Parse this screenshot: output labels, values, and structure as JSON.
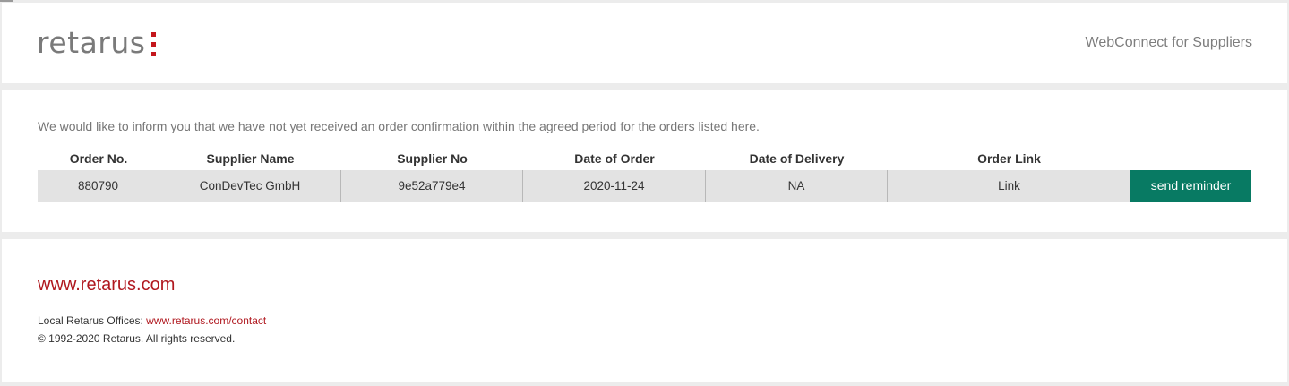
{
  "header": {
    "logo_text": "retarus",
    "title": "WebConnect for Suppliers"
  },
  "main": {
    "intro": "We would like to inform you that we have not yet received an order confirmation within the agreed period for the orders listed here.",
    "table": {
      "columns": [
        "Order No.",
        "Supplier Name",
        "Supplier No",
        "Date of Order",
        "Date of Delivery",
        "Order Link",
        ""
      ],
      "rows": [
        {
          "order_no": "880790",
          "supplier_name": "ConDevTec GmbH",
          "supplier_no": "9e52a779e4",
          "date_of_order": "2020-11-24",
          "date_of_delivery": "NA",
          "order_link": "Link",
          "action": "send reminder"
        }
      ]
    }
  },
  "footer": {
    "site_link": "www.retarus.com",
    "offices_label": "Local Retarus Offices: ",
    "offices_link": "www.retarus.com/contact",
    "copyright": "© 1992-2020 Retarus. All rights reserved."
  },
  "colors": {
    "brand_red": "#c4161c",
    "button_green": "#087a63",
    "row_bg": "#e3e3e3",
    "page_bg": "#ececec"
  }
}
